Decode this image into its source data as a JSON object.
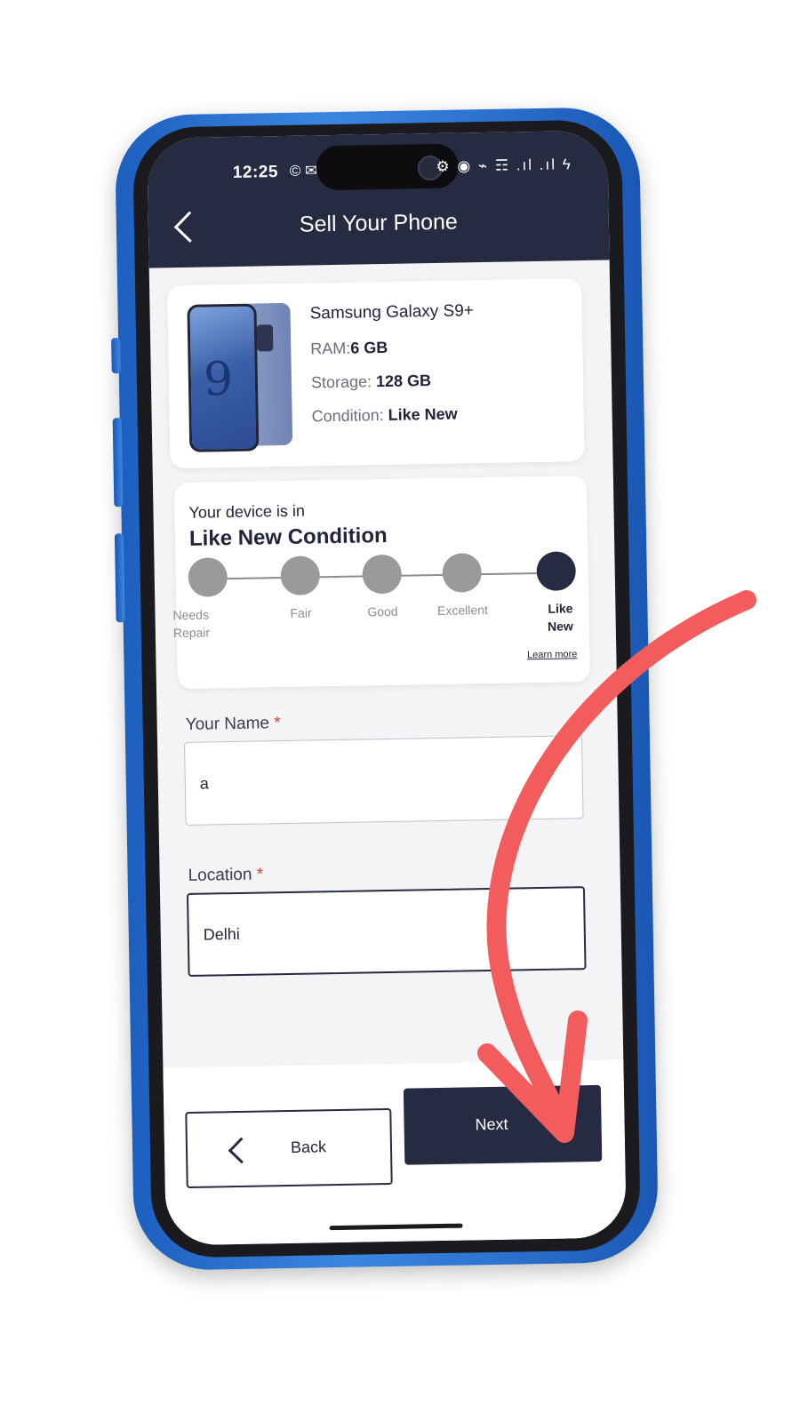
{
  "status_bar": {
    "time": "12:25",
    "app_icons": "© ✉",
    "system_icons": "⚙ ◉ ⌁ ☶ .ıl .ıl ϟ"
  },
  "header": {
    "title": "Sell Your Phone"
  },
  "product": {
    "name": "Samsung Galaxy S9+",
    "ram_label": "RAM:",
    "ram_value": "6 GB",
    "storage_label": "Storage: ",
    "storage_value": "128 GB",
    "condition_label": "Condition: ",
    "condition_value": "Like New"
  },
  "condition": {
    "caption": "Your device is in",
    "title": "Like New Condition",
    "steps": [
      {
        "label": "Needs Repair",
        "active": false
      },
      {
        "label": "Fair",
        "active": false
      },
      {
        "label": "Good",
        "active": false
      },
      {
        "label": "Excellent",
        "active": false
      },
      {
        "label": "Like New",
        "active": true
      }
    ],
    "learn_more": "Learn more"
  },
  "form": {
    "name_label": "Your Name",
    "name_value": "a",
    "location_label": "Location",
    "location_value": "Delhi",
    "required_mark": "*"
  },
  "footer": {
    "back_label": "Back",
    "next_label": "Next"
  },
  "colors": {
    "frame_blue": "#2d72cf",
    "header_navy": "#262b41",
    "required_red": "#e23b3b",
    "annotation_red": "#f25c5c"
  }
}
